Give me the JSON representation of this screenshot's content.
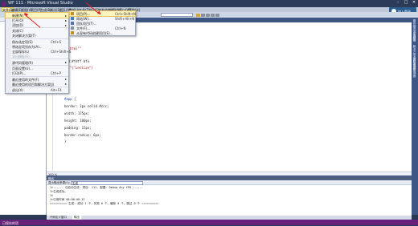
{
  "window": {
    "title": "WF 111 - Microsoft Visual Studio"
  },
  "menubar": {
    "items": [
      "文件(F)",
      "编辑(E)",
      "视图(V)",
      "项目(P)",
      "生成(B)",
      "调试(D)",
      "团队(M)",
      "数据(A)",
      "工具(T)",
      "测试(S)",
      "体系结构(C)",
      "分析(N)",
      "窗口(W)",
      "帮助(H)"
    ]
  },
  "signin": {
    "label": "加入登录"
  },
  "file_menu": {
    "items": [
      {
        "label": "新建(N)",
        "shortcut": "",
        "submenu": true,
        "highlight": true,
        "disabled": false
      },
      {
        "label": "打开(O)",
        "shortcut": "",
        "submenu": true,
        "highlight": false,
        "disabled": false
      },
      {
        "label": "添加(D)",
        "shortcut": "",
        "submenu": true,
        "highlight": false,
        "disabled": false
      },
      {
        "label": "关闭(C)",
        "shortcut": "",
        "submenu": false,
        "highlight": false,
        "disabled": false
      },
      {
        "label": "关闭解决方案(T)",
        "shortcut": "",
        "submenu": false,
        "highlight": false,
        "disabled": false
      },
      {
        "label": "保存选定项(S)",
        "shortcut": "Ctrl+S",
        "submenu": false,
        "highlight": false,
        "disabled": false
      },
      {
        "label": "将选定项另存为(A)...",
        "shortcut": "",
        "submenu": false,
        "highlight": false,
        "disabled": false
      },
      {
        "label": "全部保存(L)",
        "shortcut": "Ctrl+Shift+S",
        "submenu": false,
        "highlight": false,
        "disabled": false
      },
      {
        "label": "导出模板(E)...",
        "shortcut": "",
        "submenu": false,
        "highlight": false,
        "disabled": true
      },
      {
        "label": "源代码管理(R)",
        "shortcut": "",
        "submenu": true,
        "highlight": false,
        "disabled": false
      },
      {
        "label": "页面设置(U)...",
        "shortcut": "",
        "submenu": false,
        "highlight": false,
        "disabled": false
      },
      {
        "label": "打印(P)...",
        "shortcut": "Ctrl+P",
        "submenu": false,
        "highlight": false,
        "disabled": false
      },
      {
        "label": "最近使用的文件(F)",
        "shortcut": "",
        "submenu": true,
        "highlight": false,
        "disabled": false
      },
      {
        "label": "最近使用的项目和解决方案(J)",
        "shortcut": "",
        "submenu": true,
        "highlight": false,
        "disabled": false
      },
      {
        "label": "退出(X)",
        "shortcut": "Alt+F4",
        "submenu": false,
        "highlight": false,
        "disabled": false
      }
    ]
  },
  "new_submenu": {
    "items": [
      {
        "label": "项目(P)...",
        "shortcut": "Ctrl+Shift+N",
        "highlight": true
      },
      {
        "label": "网站(W)...",
        "shortcut": "Shift+Alt+N",
        "highlight": false
      },
      {
        "label": "团队项目(T)...",
        "shortcut": "",
        "highlight": false
      },
      {
        "label": "文件(F)...",
        "shortcut": "Ctrl+N",
        "highlight": false
      },
      {
        "label": "从现有代码创建项目(E)...",
        "shortcut": "",
        "highlight": false
      }
    ]
  },
  "editor": {
    "lines": [
      {
        "text": "ader\"=\"\"add.html\"\"",
        "cls": "red"
      },
      {
        "text": "v",
        "cls": ""
      },
      {
        "text": "  background:#fdff bfn",
        "cls": ""
      },
      {
        "text": "ackground:\"\"\"{\"unctize\"}",
        "cls": "red"
      },
      {
        "text": "ins:",
        "cls": ""
      },
      {
        "text": "#app {",
        "cls": "blue"
      },
      {
        "text": "border: 1px solid #ccc;",
        "cls": ""
      },
      {
        "text": "width: 175px;",
        "cls": ""
      },
      {
        "text": "height: 100px;",
        "cls": ""
      },
      {
        "text": "padding: 15px;",
        "cls": ""
      },
      {
        "text": "border-radius: 6px;",
        "cls": ""
      },
      {
        "text": "}",
        "cls": ""
      }
    ],
    "status": "100 %"
  },
  "output": {
    "title": "输出",
    "source_label": "显示输出来源(S):",
    "source_value": "生成",
    "lines": [
      "1>------ 已启动生成: 项目: 111, 配置: Debug Any CPU ------",
      "1>生成成功。",
      "1>",
      "1>已用时间 00:00:00.12",
      "========== 生成: 成功 1 个，失败 0 个，最新 0 个，跳过 0 个 =========="
    ]
  },
  "bottom_tabs": [
    {
      "label": "代码定义窗口",
      "active": false
    },
    {
      "label": "输出",
      "active": true
    }
  ],
  "right_tabs": [
    "服务器资源管理器",
    "工具箱",
    "解决方案资源管理器",
    "团队资源管理器"
  ],
  "statusbar": {
    "text": "已保存的项"
  },
  "colors": {
    "accent": "#68217a",
    "highlight": "#fdf4bf",
    "arrow": "#e0201e",
    "frame": "#293955"
  }
}
